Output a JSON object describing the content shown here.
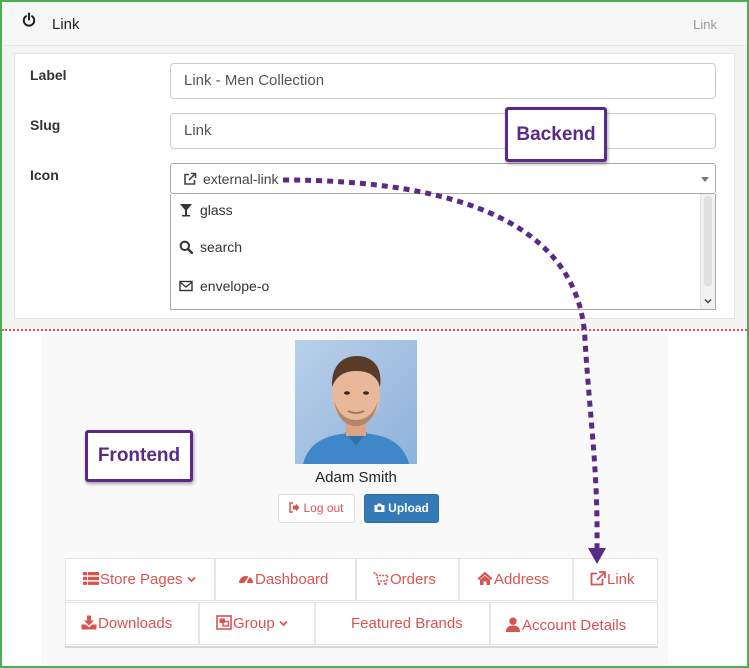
{
  "backend": {
    "header": {
      "title": "Link",
      "crumb": "Link",
      "icon": "power-icon"
    },
    "form": {
      "label": {
        "name": "Label",
        "value": "Link - Men Collection"
      },
      "slug": {
        "name": "Slug",
        "value": "Link"
      },
      "icon": {
        "name": "Icon",
        "selected": {
          "icon": "external-link-icon",
          "label": "external-link"
        },
        "options": [
          {
            "icon": "glass-icon",
            "label": "glass"
          },
          {
            "icon": "search-icon",
            "label": "search"
          },
          {
            "icon": "envelope-o-icon",
            "label": "envelope-o"
          }
        ]
      }
    }
  },
  "frontend": {
    "profile": {
      "name": "Adam Smith"
    },
    "buttons": {
      "logout": "Log out",
      "upload": "Upload"
    },
    "nav": {
      "store_pages": "Store Pages",
      "dashboard": "Dashboard",
      "orders": "Orders",
      "address": "Address",
      "link": "Link",
      "downloads": "Downloads",
      "group": "Group",
      "featured_brands": "Featured Brands",
      "account_details": "Account Details"
    }
  },
  "annotations": {
    "backend": "Backend",
    "frontend": "Frontend"
  },
  "colors": {
    "accent_purple": "#5b2a86",
    "nav_red": "#d9534f",
    "upload_blue": "#337ab7",
    "frame_green": "#4caf50"
  }
}
